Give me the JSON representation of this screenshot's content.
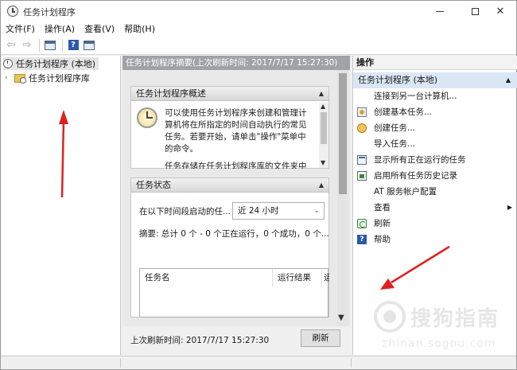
{
  "window": {
    "title": "任务计划程序",
    "minimize": "—",
    "maximize": "☐",
    "close": "✕"
  },
  "menubar": [
    "文件(F)",
    "操作(A)",
    "查看(V)",
    "帮助(H)"
  ],
  "toolbar": {
    "back": "⇦",
    "forward": "⇨",
    "help": "?"
  },
  "tree": {
    "root": "任务计划程序 (本地)",
    "library": "任务计划程序库",
    "expander": "›"
  },
  "middle": {
    "header": "任务计划程序摘要(上次刷新时间: 2017/7/17 15:27:30)",
    "overview": {
      "title": "任务计划程序概述",
      "caret": "▲",
      "description": "可以使用任务计划程序来创建和管理计算机将在所指定的时间自动执行的常见任务。若要开始，请单击\"操作\"菜单中的命令。",
      "description_more": "任务存储在任务计划程序库的文件夹中"
    },
    "status": {
      "title": "任务状态",
      "caret": "▲",
      "range_label": "在以下时间段启动的任...",
      "range_value": "近 24 小时",
      "summary": "摘要: 总计 0 个 - 0 个正在运行，0 个成功，0 个...",
      "columns": [
        "任务名",
        "运行结果",
        "运"
      ]
    },
    "footer": {
      "last_refresh": "上次刷新时间: 2017/7/17 15:27:30",
      "refresh_button": "刷新"
    }
  },
  "actions": {
    "title": "操作",
    "group": "任务计划程序 (本地)",
    "group_caret": "▲",
    "items": [
      {
        "label": "连接到另一台计算机...",
        "icon": "none"
      },
      {
        "label": "创建基本任务...",
        "icon": "create-basic-task-icon"
      },
      {
        "label": "创建任务...",
        "icon": "create-task-icon"
      },
      {
        "label": "导入任务...",
        "icon": "none"
      },
      {
        "label": "显示所有正在运行的任务",
        "icon": "running-tasks-icon"
      },
      {
        "label": "启用所有任务历史记录",
        "icon": "history-icon"
      },
      {
        "label": "AT 服务帐户配置",
        "icon": "none"
      },
      {
        "label": "查看",
        "icon": "none",
        "submenu": "▶"
      },
      {
        "label": "刷新",
        "icon": "refresh-icon"
      },
      {
        "label": "帮助",
        "icon": "help-icon"
      }
    ]
  },
  "watermark": {
    "cn": "搜狗指南",
    "en": "zhinan.sogou.com"
  },
  "colors": {
    "annotation_arrow": "#e02020",
    "selection": "#dbe6f4",
    "summary_header": "#9ea3a8"
  }
}
